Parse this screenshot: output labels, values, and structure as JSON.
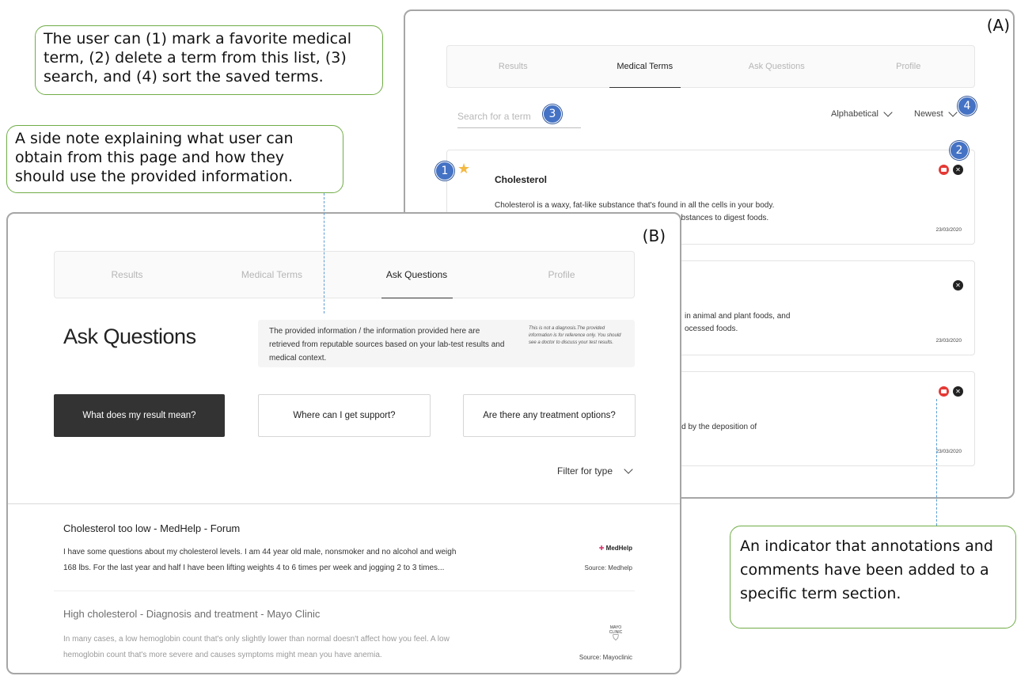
{
  "callouts": {
    "actions": "The user can (1) mark a favorite medical term, (2) delete a term from this list, (3) search, and (4) sort the saved terms.",
    "side_note": "A side note explaining what user can obtain from this page and how they should use the provided information.",
    "indicator": "An indicator that annotations and comments have been added to a specific term section."
  },
  "badges": [
    "1",
    "2",
    "3",
    "4"
  ],
  "panel_a": {
    "label": "(A)",
    "tabs": [
      {
        "label": "Results",
        "active": false
      },
      {
        "label": "Medical Terms",
        "active": true
      },
      {
        "label": "Ask Questions",
        "active": false
      },
      {
        "label": "Profile",
        "active": false
      }
    ],
    "search_placeholder": "Search for a term",
    "sort_alpha": "Alphabetical",
    "sort_newest": "Newest",
    "terms": [
      {
        "title": "Cholesterol",
        "desc_line1": "Cholesterol is a waxy, fat-like substance that's found in all the cells in your body.",
        "desc_line2": "substances to digest foods.",
        "date": "23/03/2020",
        "favorite": true,
        "has_annotation": true
      },
      {
        "title": "",
        "desc_line1": "in animal and plant foods, and",
        "desc_line2": "ocessed foods.",
        "date": "23/03/2020",
        "favorite": false,
        "has_annotation": false
      },
      {
        "title": "",
        "desc_line1": "",
        "desc_line2": "rized by the deposition of",
        "date": "23/03/2020",
        "favorite": false,
        "has_annotation": true
      }
    ],
    "icons": {
      "star": "star-icon",
      "delete": "close-icon",
      "annotation": "comment-icon"
    },
    "colors": {
      "star": "#f4b942",
      "annotation": "#e53935",
      "badge": "#4472c4",
      "callout_border": "#70ad47"
    }
  },
  "panel_b": {
    "label": "(B)",
    "tabs": [
      {
        "label": "Results",
        "active": false
      },
      {
        "label": "Medical Terms",
        "active": false
      },
      {
        "label": "Ask Questions",
        "active": true
      },
      {
        "label": "Profile",
        "active": false
      }
    ],
    "title": "Ask Questions",
    "side_main": "The provided information / the information provided here are retrieved from reputable sources based on your lab-test results and medical context.",
    "side_disclaimer": "This is not a diagnosis.The provided information is for reference only. You should see a doctor to discuss your test results.",
    "questions": [
      "What does my result mean?",
      "Where can I get support?",
      "Are there any treatment options?"
    ],
    "filter_label": "Filter for type",
    "results": [
      {
        "title": "Cholesterol too low - MedHelp - Forum",
        "text_line1": "I have some questions about my cholesterol levels.  I am 44 year old male, nonsmoker and no alcohol and weigh",
        "text_line2": "168 lbs. For the last year and half I have been lifting weights 4 to 6 times per week and jogging 2 to 3 times...",
        "logo": "MedHelp",
        "source": "Source: Medhelp"
      },
      {
        "title": "High cholesterol - Diagnosis and treatment - Mayo Clinic",
        "text_line1": "In many cases, a low hemoglobin count that's only slightly lower than normal doesn't affect how you feel. A low",
        "text_line2": "hemoglobin count that's more severe and causes symptoms might mean you have anemia.",
        "logo": "MAYO CLINIC",
        "source": "Source: Mayoclinic"
      }
    ]
  }
}
